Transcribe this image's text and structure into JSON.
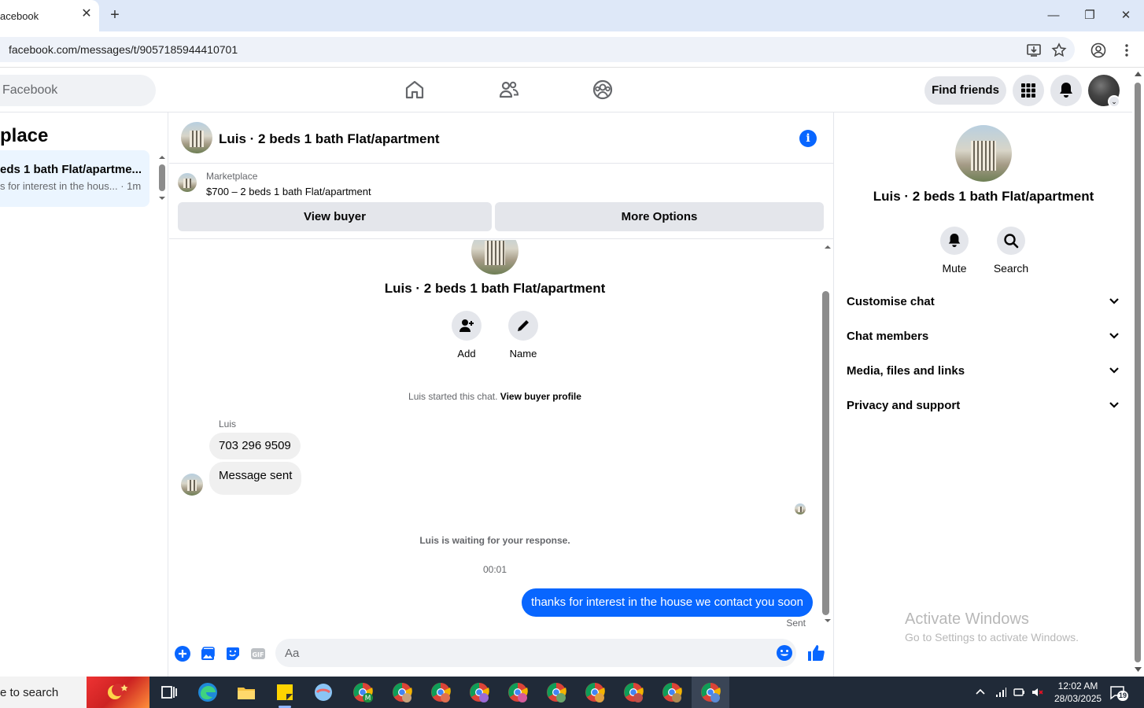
{
  "browser": {
    "tab_title": "acebook",
    "url": "facebook.com/messages/t/9057185944410701"
  },
  "header": {
    "search_placeholder": "Facebook",
    "find_friends_label": "Find friends"
  },
  "left_panel": {
    "heading": "place",
    "conversation": {
      "title": "eds 1 bath Flat/apartme...",
      "preview": "s for interest in the hous... · 1m"
    }
  },
  "chat": {
    "title": "Luis · 2 beds 1 bath Flat/apartment",
    "marketplace_label": "Marketplace",
    "listing": "$700 – 2 beds 1 bath Flat/apartment",
    "view_buyer_label": "View buyer",
    "more_options_label": "More Options",
    "big_name": "Luis · 2 beds 1 bath Flat/apartment",
    "add_label": "Add",
    "name_label": "Name",
    "started_text": "Luis started this chat.",
    "view_profile_link": "View buyer profile",
    "sender_name": "Luis",
    "messages_in": [
      "703 296 9509",
      "Message sent"
    ],
    "waiting_text": "Luis is waiting for your response.",
    "timestamp": "00:01",
    "message_out": "thanks for interest in the house we contact you soon",
    "sent_label": "Sent",
    "composer_placeholder": "Aa"
  },
  "right_panel": {
    "name": "Luis · 2 beds 1 bath Flat/apartment",
    "mute_label": "Mute",
    "search_label": "Search",
    "sections": [
      "Customise chat",
      "Chat members",
      "Media, files and links",
      "Privacy and support"
    ],
    "activate_title": "Activate Windows",
    "activate_sub": "Go to Settings to activate Windows."
  },
  "taskbar": {
    "search_text": "e to search",
    "time": "12:02 AM",
    "date": "28/03/2025",
    "notification_count": "19"
  },
  "colors": {
    "accent": "#0866ff",
    "bubble_in": "#f0f0f0",
    "selected_convo": "#ebf5ff"
  }
}
